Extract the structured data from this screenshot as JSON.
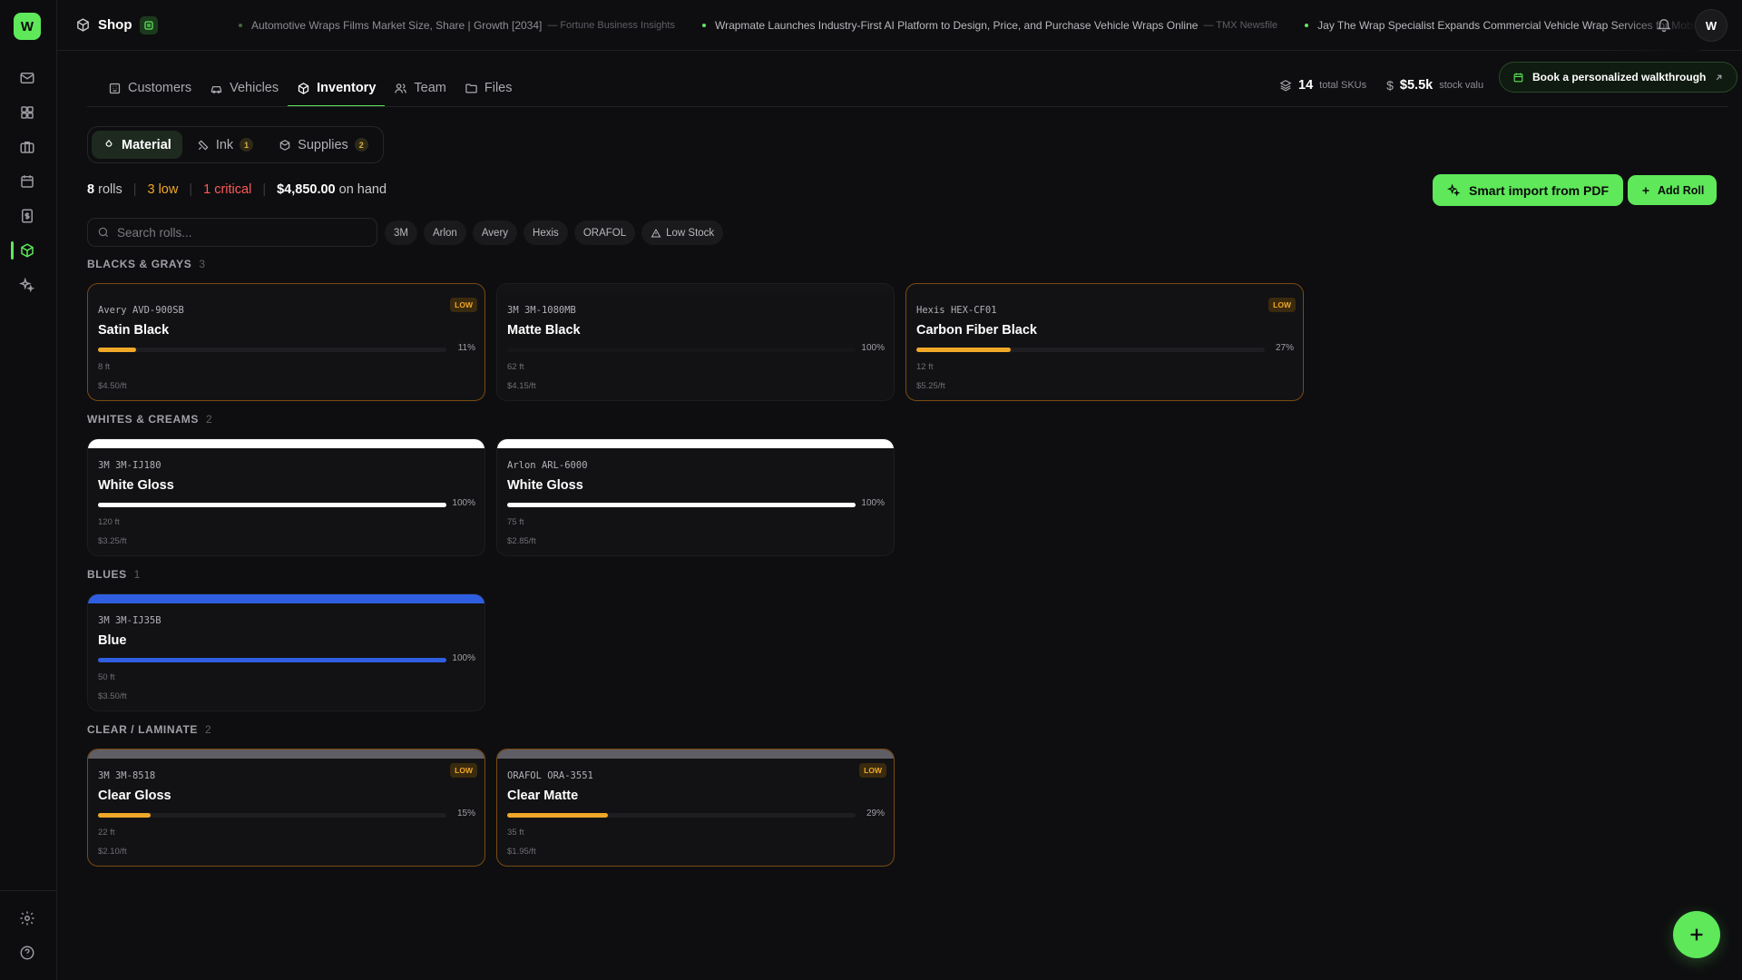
{
  "app": {
    "logo_letter": "W",
    "shop_name": "Shop",
    "user_initial": "W",
    "accent": "#5ee85a"
  },
  "ticker": [
    {
      "headline": "Automotive Wraps Films Market Size, Share | Growth [2034]",
      "source": "— Fortune Business Insights",
      "dim": true
    },
    {
      "headline": "Wrapmate Launches Industry-First AI Platform to Design, Price, and Purchase Vehicle Wraps Online",
      "source": "— TMX Newsfile",
      "dim": false
    },
    {
      "headline": "Jay The Wrap Specialist Expands Commercial Vehicle Wrap Services for Mobile",
      "source": "",
      "dim": false
    }
  ],
  "tabs": [
    {
      "label": "Customers",
      "icon": "building-icon"
    },
    {
      "label": "Vehicles",
      "icon": "car-icon"
    },
    {
      "label": "Inventory",
      "icon": "package-icon",
      "active": true
    },
    {
      "label": "Team",
      "icon": "users-icon"
    },
    {
      "label": "Files",
      "icon": "folder-icon"
    }
  ],
  "stats": {
    "skus": "14",
    "skus_label": "total SKUs",
    "value": "$5.5k",
    "value_label": "stock valu"
  },
  "walkthrough": {
    "label": "Book a personalized walkthrough"
  },
  "segments": [
    {
      "label": "Material",
      "count": "",
      "active": true
    },
    {
      "label": "Ink",
      "count": "1"
    },
    {
      "label": "Supplies",
      "count": "2"
    }
  ],
  "summary": {
    "rolls_num": "8",
    "rolls_label": "rolls",
    "low": "3 low",
    "critical": "1 critical",
    "on_hand_value": "$4,850.00",
    "on_hand_label": "on hand"
  },
  "actions": {
    "smart_import": "Smart import from PDF",
    "add_roll": "Add Roll"
  },
  "search": {
    "placeholder": "Search rolls..."
  },
  "filters": [
    "3M",
    "Arlon",
    "Avery",
    "Hexis",
    "ORAFOL",
    "Low Stock"
  ],
  "colors": {
    "low": "#f0a828",
    "critical": "#ff5a5a",
    "white_roll": "#ffffff",
    "blue_roll": "#2f5fe0",
    "clear_roll": "#6a6a70"
  },
  "sections": [
    {
      "title": "BLACKS & GRAYS",
      "count": "3",
      "cards": [
        {
          "brand": "Avery",
          "code": "AVD-900SB",
          "name": "Satin Black",
          "pct": 11,
          "pct_label": "11%",
          "length": "8 ft",
          "price": "$4.50/ft",
          "low": true,
          "low_label": "LOW",
          "stripe": "",
          "fill": "#f0a828"
        },
        {
          "brand": "3M",
          "code": "3M-1080MB",
          "name": "Matte Black",
          "pct": 100,
          "pct_label": "100%",
          "length": "62 ft",
          "price": "$4.15/ft",
          "low": false,
          "stripe": "#141416",
          "fill": "#161618"
        },
        {
          "brand": "Hexis",
          "code": "HEX-CF01",
          "name": "Carbon Fiber Black",
          "pct": 27,
          "pct_label": "27%",
          "length": "12 ft",
          "price": "$5.25/ft",
          "low": true,
          "low_label": "LOW",
          "stripe": "",
          "fill": "#f0a828"
        }
      ]
    },
    {
      "title": "WHITES & CREAMS",
      "count": "2",
      "cards": [
        {
          "brand": "3M",
          "code": "3M-IJ180",
          "name": "White Gloss",
          "pct": 100,
          "pct_label": "100%",
          "length": "120 ft",
          "price": "$3.25/ft",
          "low": false,
          "stripe": "#ffffff",
          "fill": "#ffffff"
        },
        {
          "brand": "Arlon",
          "code": "ARL-6000",
          "name": "White Gloss",
          "pct": 100,
          "pct_label": "100%",
          "length": "75 ft",
          "price": "$2.85/ft",
          "low": false,
          "stripe": "#ffffff",
          "fill": "#ffffff"
        }
      ]
    },
    {
      "title": "BLUES",
      "count": "1",
      "cards": [
        {
          "brand": "3M",
          "code": "3M-IJ35B",
          "name": "Blue",
          "pct": 100,
          "pct_label": "100%",
          "length": "50 ft",
          "price": "$3.50/ft",
          "low": false,
          "stripe": "#2f5fe0",
          "fill": "#2f5fe0"
        }
      ]
    },
    {
      "title": "CLEAR / LAMINATE",
      "count": "2",
      "cards": [
        {
          "brand": "3M",
          "code": "3M-8518",
          "name": "Clear Gloss",
          "pct": 15,
          "pct_label": "15%",
          "length": "22 ft",
          "price": "$2.10/ft",
          "low": true,
          "low_label": "LOW",
          "stripe": "#5e5e64",
          "fill": "#f0a828"
        },
        {
          "brand": "ORAFOL",
          "code": "ORA-3551",
          "name": "Clear Matte",
          "pct": 29,
          "pct_label": "29%",
          "length": "35 ft",
          "price": "$1.95/ft",
          "low": true,
          "low_label": "LOW",
          "stripe": "#5e5e64",
          "fill": "#f0a828"
        }
      ]
    }
  ]
}
